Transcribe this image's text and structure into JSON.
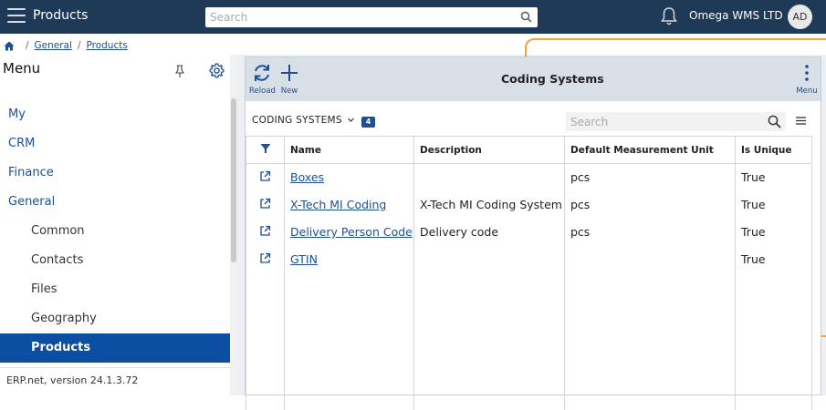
{
  "app": {
    "title": "Products",
    "search_placeholder": "Search",
    "company": "Omega WMS LTD",
    "avatar_initials": "AD"
  },
  "breadcrumb": {
    "items": [
      "General",
      "Products"
    ]
  },
  "sidebar": {
    "header": "Menu",
    "items": [
      {
        "label": "My",
        "level": 0
      },
      {
        "label": "CRM",
        "level": 0
      },
      {
        "label": "Finance",
        "level": 0
      },
      {
        "label": "General",
        "level": 0
      },
      {
        "label": "Common",
        "level": 1
      },
      {
        "label": "Contacts",
        "level": 1
      },
      {
        "label": "Files",
        "level": 1
      },
      {
        "label": "Geography",
        "level": 1
      },
      {
        "label": "Products",
        "level": 1,
        "active": true
      }
    ],
    "version": "ERP.net, version 24.1.3.72"
  },
  "panel": {
    "title": "Coding Systems",
    "toolbar": {
      "reload_label": "Reload",
      "new_label": "New",
      "menu_label": "Menu"
    },
    "grid": {
      "name": "CODING SYSTEMS",
      "count": "4",
      "search_placeholder": "Search",
      "columns": [
        "Name",
        "Description",
        "Default Measurement Unit",
        "Is Unique"
      ],
      "rows": [
        {
          "name": "Boxes",
          "description": "",
          "unit": "pcs",
          "unique": "True"
        },
        {
          "name": "X-Tech MI Coding",
          "description": "X-Tech MI Coding System",
          "unit": "pcs",
          "unique": "True"
        },
        {
          "name": "Delivery Person Code",
          "description": "Delivery code",
          "unit": "pcs",
          "unique": "True"
        },
        {
          "name": "GTIN",
          "description": "",
          "unit": "",
          "unique": "True"
        }
      ]
    }
  },
  "colors": {
    "topbar": "#1f3a56",
    "accent": "#1d4f91",
    "active_menu": "#0c4ea2",
    "highlight_frame": "#f0a33a"
  }
}
